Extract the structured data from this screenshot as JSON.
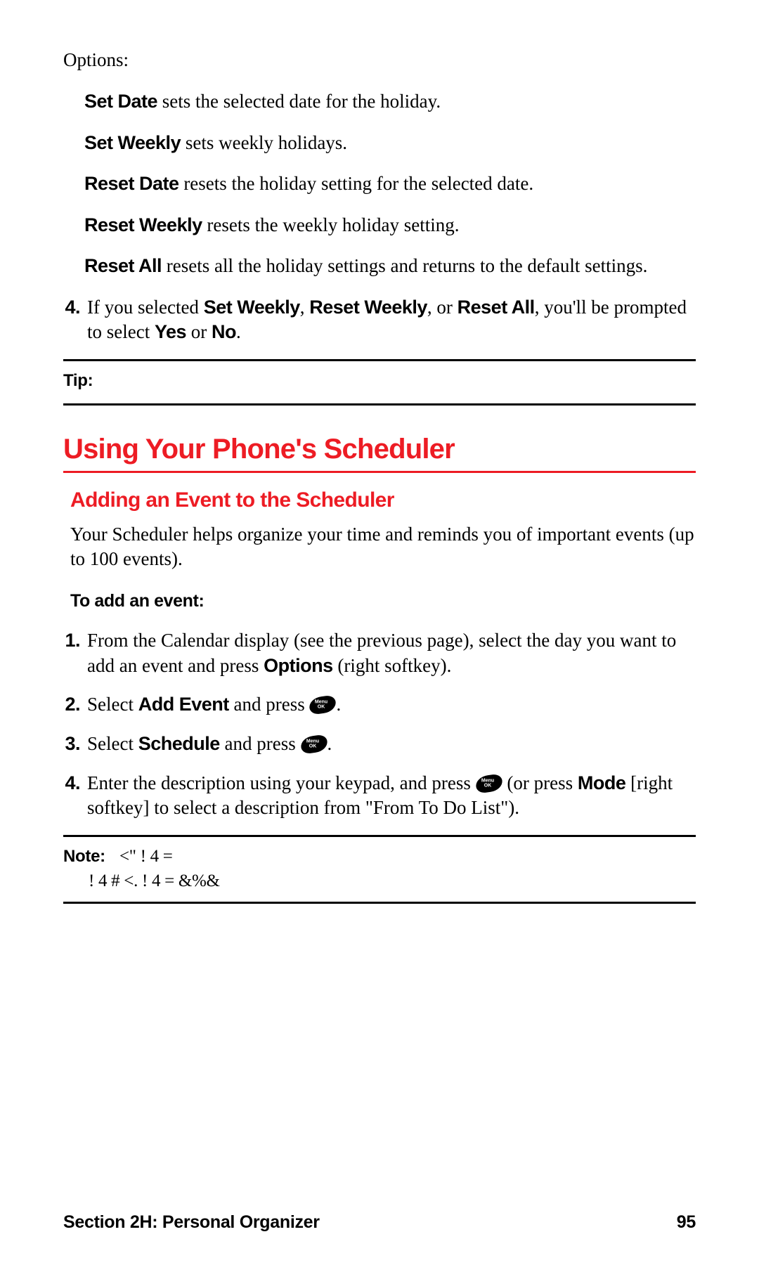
{
  "options_label": "Options:",
  "options": [
    {
      "name": "Set Date",
      "desc": " sets the selected date for the holiday."
    },
    {
      "name": "Set Weekly",
      "desc": " sets weekly holidays."
    },
    {
      "name": "Reset Date",
      "desc": " resets the holiday setting for the selected date."
    },
    {
      "name": "Reset Weekly",
      "desc": " resets the weekly holiday setting."
    },
    {
      "name": "Reset All",
      "desc": " resets all the holiday settings and returns to the default settings."
    }
  ],
  "num_item4": {
    "marker": "4.",
    "pre": "If you selected ",
    "b1": "Set Weekly",
    "sep1": ", ",
    "b2": "Reset Weekly",
    "sep2": ", or ",
    "b3": "Reset All",
    "mid": ", you'll be prompted to select ",
    "b4": "Yes",
    "or": " or ",
    "b5": "No",
    "end": "."
  },
  "tip_label": "Tip:",
  "h1": "Using Your Phone's Scheduler",
  "h2": "Adding an Event to the Scheduler",
  "intro": "Your Scheduler helps organize your time and reminds you of important events (up to 100 events).",
  "subhead": "To add an event:",
  "steps": [
    {
      "marker": "1.",
      "pre": "From the Calendar display (see the previous page), select the day you want to add an event and press ",
      "b1": "Options",
      "post": " (right softkey)."
    },
    {
      "marker": "2.",
      "pre": "Select ",
      "b1": "Add Event",
      "mid": " and press ",
      "icon": true,
      "post": "."
    },
    {
      "marker": "3.",
      "pre": "Select ",
      "b1": "Schedule",
      "mid": " and press ",
      "icon": true,
      "post": "."
    },
    {
      "marker": "4.",
      "pre": "Enter the description using your keypad, and press ",
      "icon": true,
      "mid": " (or press ",
      "b1": "Mode",
      "post": " [right softkey] to select a description from \"From To Do List\")."
    }
  ],
  "note_label": "Note:",
  "note_line1": "<\"      !  4    =",
  "note_line2": "!  4    #   <.        !  4       =       &%&",
  "footer_left": "Section 2H: Personal Organizer",
  "footer_right": "95"
}
